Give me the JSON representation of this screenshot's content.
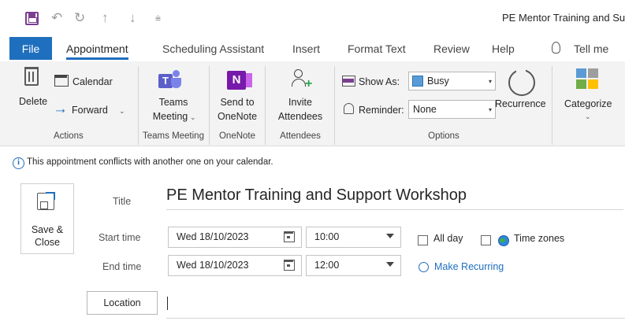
{
  "window": {
    "title": "PE Mentor Training and Support Workshop"
  },
  "quick_access": {
    "icons": [
      "save-icon",
      "undo-icon",
      "redo-icon",
      "up-arrow-icon",
      "down-arrow-icon",
      "customize-icon"
    ],
    "glyphs": {
      "undo": "↶",
      "redo": "↻",
      "up": "↑",
      "down": "↓",
      "customize": "⩧"
    }
  },
  "tabs": [
    {
      "label": "File"
    },
    {
      "label": "Appointment"
    },
    {
      "label": "Scheduling Assistant"
    },
    {
      "label": "Insert"
    },
    {
      "label": "Format Text"
    },
    {
      "label": "Review"
    },
    {
      "label": "Help"
    },
    {
      "label": "Tell me"
    }
  ],
  "ribbon": {
    "actions": {
      "delete": "Delete",
      "calendar": "Calendar",
      "forward": "Forward",
      "group": "Actions"
    },
    "teams": {
      "button_line1": "Teams",
      "button_line2": "Meeting",
      "group": "Teams Meeting"
    },
    "onenote": {
      "button_line1": "Send to",
      "button_line2": "OneNote",
      "group": "OneNote"
    },
    "attendees": {
      "button_line1": "Invite",
      "button_line2": "Attendees",
      "group": "Attendees"
    },
    "options": {
      "show_as_label": "Show As:",
      "show_as_value": "Busy",
      "reminder_label": "Reminder:",
      "reminder_value": "None",
      "recurrence": "Recurrence",
      "group": "Options"
    },
    "categorize": {
      "label": "Categorize"
    },
    "colors": {
      "accent": "#1f6fbf",
      "busy": "#5b9bd5",
      "categories": [
        "#5b9bd5",
        "#9e9e9e",
        "#70ad47",
        "#ffc000"
      ]
    }
  },
  "infobar": {
    "text": "This appointment conflicts with another one on your calendar."
  },
  "form": {
    "save_close_line1": "Save &",
    "save_close_line2": "Close",
    "title_label": "Title",
    "title_value": "PE Mentor Training and Support Workshop",
    "start_label": "Start time",
    "start_date": "Wed 18/10/2023",
    "start_time": "10:00",
    "end_label": "End time",
    "end_date": "Wed 18/10/2023",
    "end_time": "12:00",
    "all_day": "All day",
    "time_zones": "Time zones",
    "make_recurring": "Make Recurring",
    "location_label": "Location",
    "location_value": ""
  }
}
